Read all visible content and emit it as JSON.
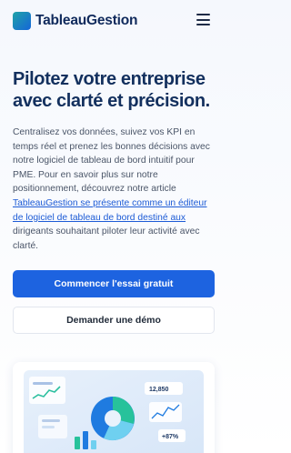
{
  "header": {
    "brand": "TableauGestion",
    "logo_icon": "square-logo-icon",
    "menu_icon": "hamburger-icon"
  },
  "hero": {
    "title": "Pilotez votre entreprise avec clarté et précision.",
    "text_before_link": "Centralisez vos données, suivez vos KPI en temps réel et prenez les bonnes décisions avec notre logiciel de tableau de bord intuitif pour PME. Pour en savoir plus sur notre positionnement, découvrez notre article ",
    "link_text": "TableauGestion se présente comme un éditeur de logiciel de tableau de bord destiné aux",
    "text_after_link": " dirigeants souhaitant piloter leur activité avec clarté.",
    "primary_button": "Commencer l'essai gratuit",
    "secondary_button": "Demander une démo"
  },
  "preview": {
    "image_icon": "dashboard-illustration",
    "badge_1": "12,850",
    "badge_2": "+87%"
  },
  "colors": {
    "accent": "#1d63e0",
    "title": "#13305e",
    "logo_gradient_start": "#1fa3a8",
    "logo_gradient_end": "#1566d8"
  }
}
